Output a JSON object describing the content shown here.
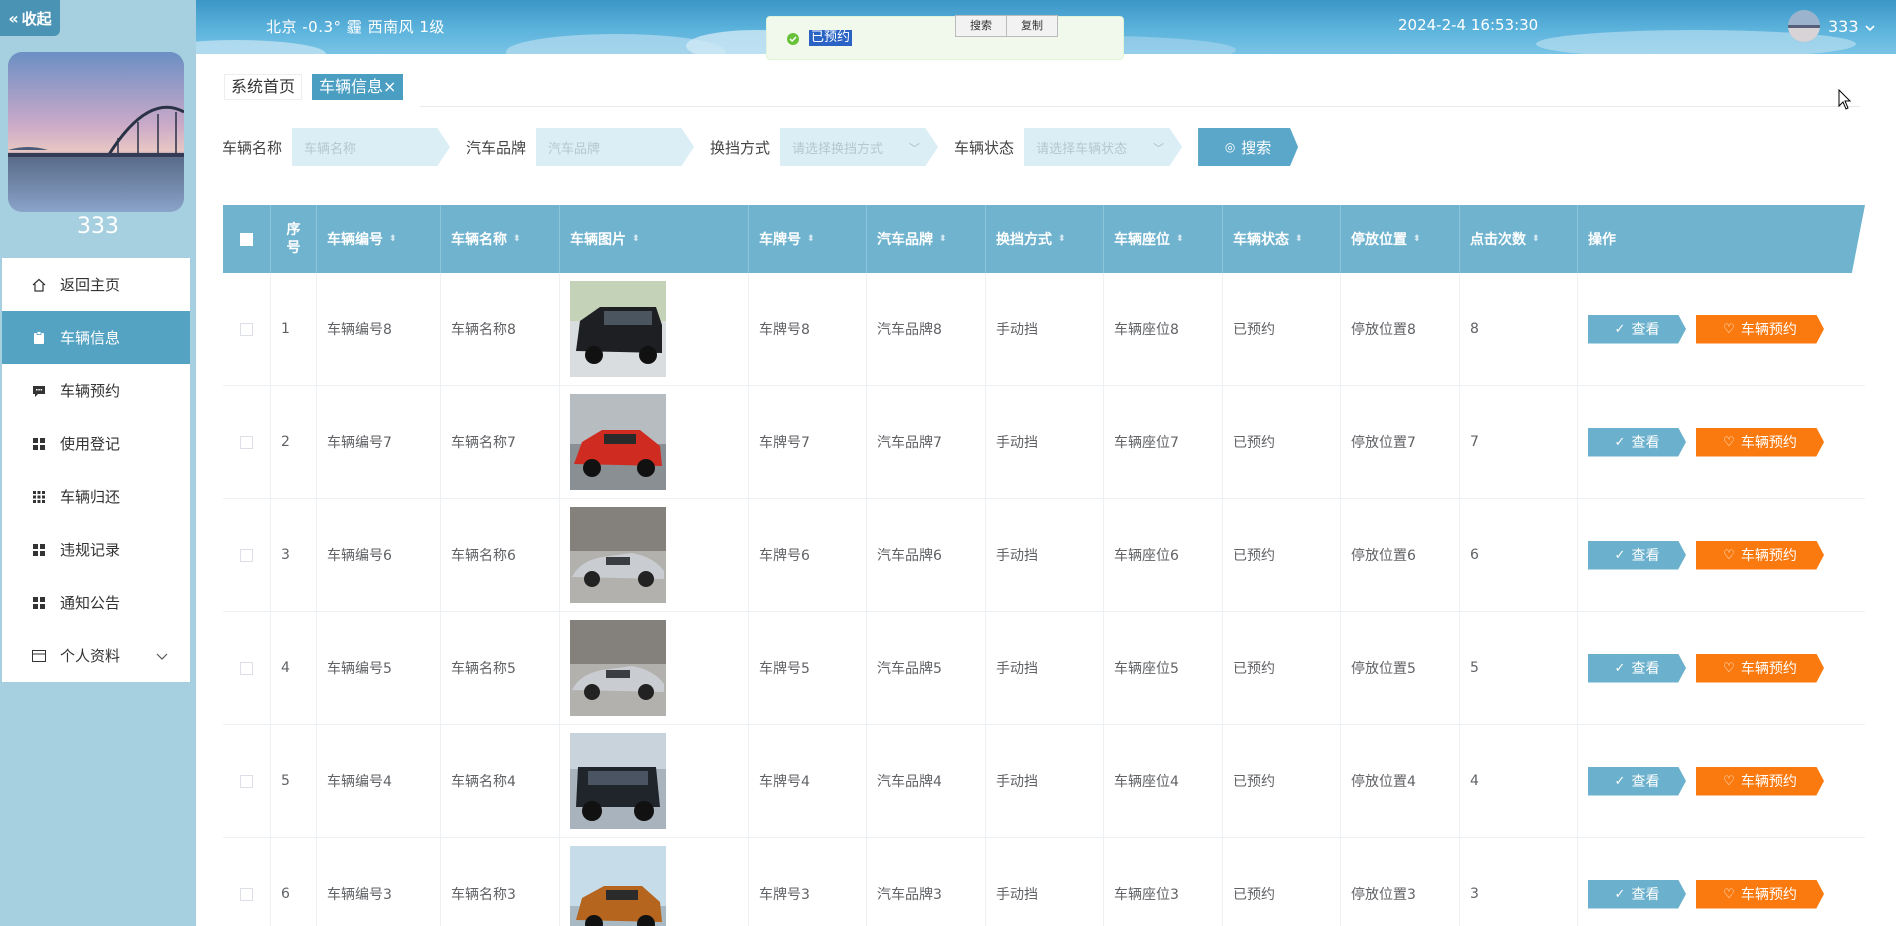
{
  "sidebar": {
    "collapse_label": "收起",
    "username": "333",
    "menu": [
      {
        "label": "返回主页",
        "icon": "home-icon"
      },
      {
        "label": "车辆信息",
        "icon": "clipboard-icon",
        "active": true
      },
      {
        "label": "车辆预约",
        "icon": "message-icon"
      },
      {
        "label": "使用登记",
        "icon": "grid-icon"
      },
      {
        "label": "车辆归还",
        "icon": "grid-9-icon"
      },
      {
        "label": "违规记录",
        "icon": "grid-icon"
      },
      {
        "label": "通知公告",
        "icon": "grid-icon"
      },
      {
        "label": "个人资料",
        "icon": "card-icon",
        "has_submenu": true
      }
    ]
  },
  "header": {
    "weather": "北京  -0.3°  霾  西南风  1级",
    "datetime": "2024-2-4 16:53:30",
    "user": "333"
  },
  "toast": {
    "message": "已预约",
    "context_menu": [
      "搜索",
      "复制"
    ]
  },
  "breadcrumb": {
    "home": "系统首页",
    "current": "车辆信息",
    "close": "×"
  },
  "search": {
    "fields": [
      {
        "label": "车辆名称",
        "placeholder": "车辆名称",
        "type": "input"
      },
      {
        "label": "汽车品牌",
        "placeholder": "汽车品牌",
        "type": "input"
      },
      {
        "label": "换挡方式",
        "placeholder": "请选择换挡方式",
        "type": "select"
      },
      {
        "label": "车辆状态",
        "placeholder": "请选择车辆状态",
        "type": "select"
      }
    ],
    "button": "搜索"
  },
  "table": {
    "columns": [
      "序号",
      "车辆编号",
      "车辆名称",
      "车辆图片",
      "车牌号",
      "汽车品牌",
      "换挡方式",
      "车辆座位",
      "车辆状态",
      "停放位置",
      "点击次数",
      "操作"
    ],
    "seq_header": [
      "序",
      "号"
    ],
    "view_label": "查看",
    "book_label": "车辆预约",
    "rows": [
      {
        "seq": "1",
        "code": "车辆编号8",
        "name": "车辆名称8",
        "image": "black-van",
        "plate": "车牌号8",
        "brand": "汽车品牌8",
        "gear": "手动挡",
        "seat": "车辆座位8",
        "status": "已预约",
        "park": "停放位置8",
        "clicks": "8"
      },
      {
        "seq": "2",
        "code": "车辆编号7",
        "name": "车辆名称7",
        "image": "red-suv",
        "plate": "车牌号7",
        "brand": "汽车品牌7",
        "gear": "手动挡",
        "seat": "车辆座位7",
        "status": "已预约",
        "park": "停放位置7",
        "clicks": "7"
      },
      {
        "seq": "3",
        "code": "车辆编号6",
        "name": "车辆名称6",
        "image": "silver-sports",
        "plate": "车牌号6",
        "brand": "汽车品牌6",
        "gear": "手动挡",
        "seat": "车辆座位6",
        "status": "已预约",
        "park": "停放位置6",
        "clicks": "6"
      },
      {
        "seq": "4",
        "code": "车辆编号5",
        "name": "车辆名称5",
        "image": "silver-sports",
        "plate": "车牌号5",
        "brand": "汽车品牌5",
        "gear": "手动挡",
        "seat": "车辆座位5",
        "status": "已预约",
        "park": "停放位置5",
        "clicks": "5"
      },
      {
        "seq": "5",
        "code": "车辆编号4",
        "name": "车辆名称4",
        "image": "dark-offroad",
        "plate": "车牌号4",
        "brand": "汽车品牌4",
        "gear": "手动挡",
        "seat": "车辆座位4",
        "status": "已预约",
        "park": "停放位置4",
        "clicks": "4"
      },
      {
        "seq": "6",
        "code": "车辆编号3",
        "name": "车辆名称3",
        "image": "orange-suv",
        "plate": "车牌号3",
        "brand": "汽车品牌3",
        "gear": "手动挡",
        "seat": "车辆座位3",
        "status": "已预约",
        "park": "停放位置3",
        "clicks": "3"
      }
    ]
  },
  "colors": {
    "accent": "#55a3c3",
    "header": "#4aa3d1",
    "book_button": "#fb7a0f",
    "view_button": "#6bb0cc"
  }
}
